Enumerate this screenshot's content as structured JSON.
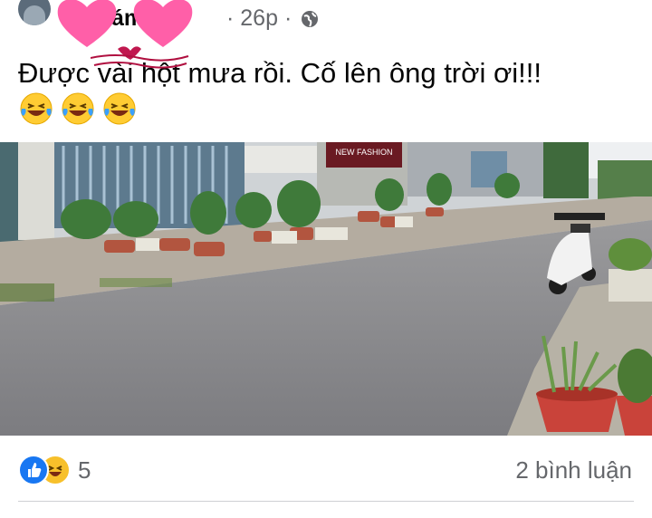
{
  "post": {
    "author_visible": "ôi",
    "author_suffix": "ám",
    "time": "26p",
    "separator": "·",
    "privacy_icon": "globe-icon",
    "text": "Được vài hột mưa rồi. Cố lên ông trời ơi!!!",
    "emojis": [
      "laughing-tears-emoji",
      "laughing-tears-emoji",
      "laughing-tears-emoji"
    ],
    "photo_sign": "NEW FASHION"
  },
  "footer": {
    "reaction_icons": [
      "like-icon",
      "haha-icon"
    ],
    "reaction_count": "5",
    "comments": "2 bình luận"
  },
  "colors": {
    "meta_gray": "#65676b",
    "text": "#050505",
    "like_blue": "#1877f2",
    "haha_yellow": "#f7c02b",
    "heart_pink": "#ff5fa8"
  }
}
